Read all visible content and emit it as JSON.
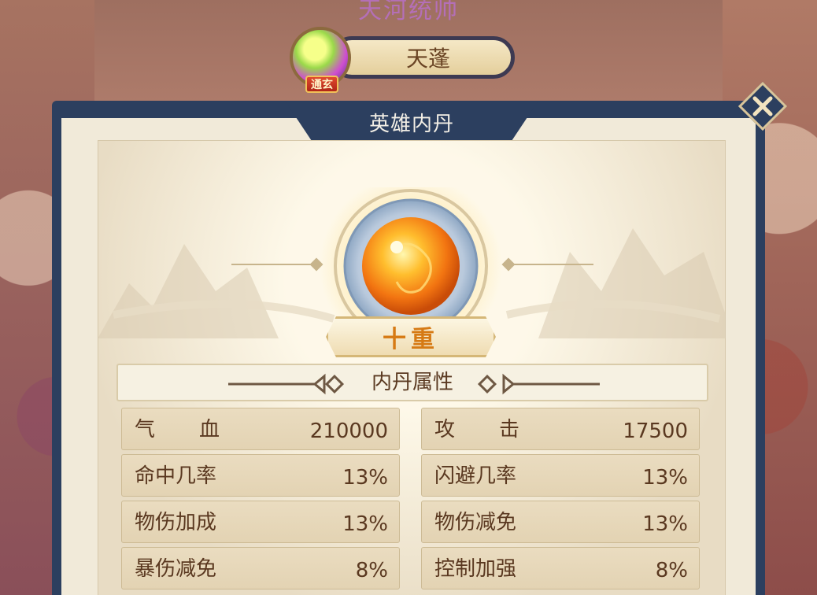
{
  "header": {
    "top_title": "天河统帅",
    "hero_name": "天蓬",
    "hero_rank_badge": "通玄"
  },
  "panel": {
    "title": "英雄内丹",
    "close_icon": "close-icon"
  },
  "core": {
    "level_label": "十重"
  },
  "attributes": {
    "section_title": "内丹属性",
    "left": [
      {
        "label": "气血",
        "value": "210000"
      },
      {
        "label": "命中几率",
        "value": "13%"
      },
      {
        "label": "物伤加成",
        "value": "13%"
      },
      {
        "label": "暴伤减免",
        "value": "8%"
      }
    ],
    "right": [
      {
        "label": "攻击",
        "value": "17500"
      },
      {
        "label": "闪避几率",
        "value": "13%"
      },
      {
        "label": "物伤减免",
        "value": "13%"
      },
      {
        "label": "控制加强",
        "value": "8%"
      }
    ]
  },
  "colors": {
    "panel_frame": "#2c3f5f",
    "panel_bg": "#f1ead9",
    "text_brown": "#5a3820",
    "level_orange": "#d67a14"
  }
}
